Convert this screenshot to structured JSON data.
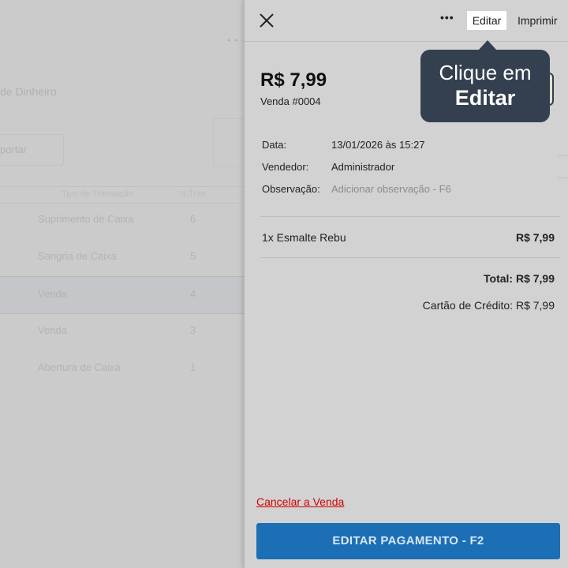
{
  "background": {
    "title": "de Dinheiro",
    "export_label": "portar",
    "table": {
      "headers": [
        "Tipo de Transação",
        "N.Tran"
      ],
      "rows": [
        {
          "type": "Suprimento de Caixa",
          "num": "6"
        },
        {
          "type": "Sangria de Caixa",
          "num": "5"
        },
        {
          "type": "Venda",
          "num": "4"
        },
        {
          "type": "Venda",
          "num": "3"
        },
        {
          "type": "Abertura de Caixa",
          "num": "1"
        }
      ],
      "selected_index": 2
    }
  },
  "panel": {
    "toolbar": {
      "more_label": "•••",
      "edit_label": "Editar",
      "print_label": "Imprimir"
    },
    "amount": "R$ 7,99",
    "sale_number": "Venda #0004",
    "info": {
      "date_label": "Data:",
      "date_value": "13/01/2026 às 15:27",
      "seller_label": "Vendedor:",
      "seller_value": "Administrador",
      "note_label": "Observação:",
      "note_placeholder": "Adicionar observação - F6"
    },
    "item": {
      "name": "1x Esmalte Rebu",
      "price": "R$ 7,99"
    },
    "total": "Total: R$ 7,99",
    "payment": "Cartão de Crédito: R$ 7,99",
    "cancel_label": "Cancelar a Venda",
    "pay_button_label": "EDITAR PAGAMENTO - F2"
  },
  "tooltip": {
    "line1": "Clique em",
    "line2": "Editar"
  },
  "colors": {
    "accent": "#1c6fb5",
    "danger": "#d40000",
    "tooltip_bg": "#34404f"
  }
}
